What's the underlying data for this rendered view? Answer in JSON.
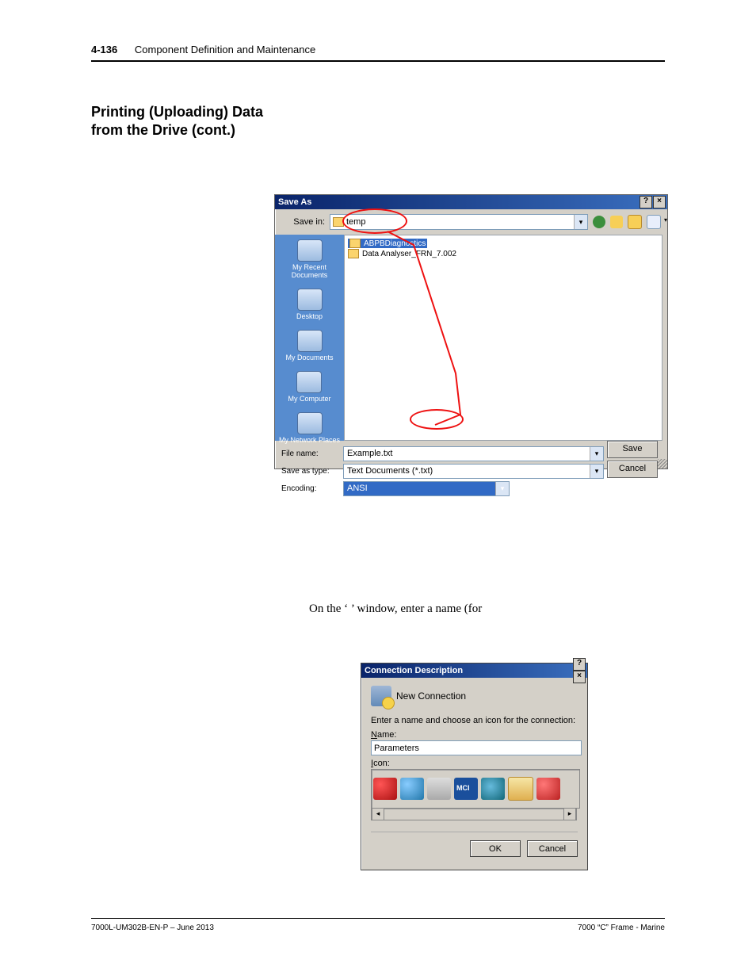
{
  "header": {
    "page_num": "4-136",
    "chapter": "Component Definition and Maintenance"
  },
  "section_title": "Printing (Uploading) Data from the Drive (cont.)",
  "save_as": {
    "title": "Save As",
    "help_btn": "?",
    "close_btn": "×",
    "save_in_label": "Save in:",
    "save_in_value": "temp",
    "nav": {
      "back": "back-icon",
      "up": "up-one-level-icon",
      "newfolder": "new-folder-icon",
      "views": "views-icon"
    },
    "places": [
      "My Recent Documents",
      "Desktop",
      "My Documents",
      "My Computer",
      "My Network Places"
    ],
    "files": [
      {
        "name": "ABPBDiagnostics",
        "selected": true
      },
      {
        "name": "Data Analyser_FRN_7.002",
        "selected": false
      }
    ],
    "filename_label": "File name:",
    "filename_value": "Example.txt",
    "saveastype_label": "Save as type:",
    "saveastype_value": "Text Documents (*.txt)",
    "encoding_label": "Encoding:",
    "encoding_value": "ANSI",
    "save_btn": "Save",
    "cancel_btn": "Cancel"
  },
  "body_text": {
    "pre": "On the ‘",
    "dialog_name": "",
    "post": "’ window, enter a name (for"
  },
  "conn_desc": {
    "title": "Connection Description",
    "help_btn": "?",
    "close_btn": "×",
    "heading": "New Connection",
    "prompt": "Enter a name and choose an icon for the connection:",
    "name_label": "Name:",
    "name_value": "Parameters",
    "icon_label": "Icon:",
    "ok": "OK",
    "cancel": "Cancel"
  },
  "footer": {
    "left": "7000L-UM302B-EN-P – June 2013",
    "right": "7000 “C” Frame - Marine"
  }
}
